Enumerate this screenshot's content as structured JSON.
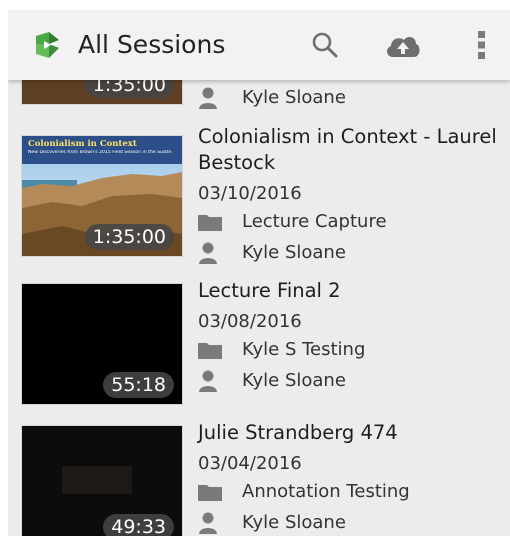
{
  "appbar": {
    "title": "All Sessions",
    "actions": [
      {
        "icon": "search-icon"
      },
      {
        "icon": "cloud-upload-icon"
      },
      {
        "icon": "more-vert-icon"
      }
    ],
    "logo_color": "#3d9a3a"
  },
  "sessions": [
    {
      "title": "",
      "date": "",
      "folder": "",
      "owner": "Kyle Sloane",
      "duration": "1:35:00",
      "thumbnail": "desert"
    },
    {
      "title": "Colonialism in Context - Laurel Bestock",
      "date": "03/10/2016",
      "folder": "Lecture Capture",
      "owner": "Kyle Sloane",
      "duration": "1:35:00",
      "thumbnail": "desert",
      "thumb_heading": "Colonialism in Context",
      "thumb_subheading": "New Discoveries from Brown's 2015 Field Season in the Sudan"
    },
    {
      "title": "Lecture Final 2",
      "date": "03/08/2016",
      "folder": "Kyle S Testing",
      "owner": "Kyle Sloane",
      "duration": "55:18",
      "thumbnail": "black"
    },
    {
      "title": "Julie Strandberg 474",
      "date": "03/04/2016",
      "folder": "Annotation Testing",
      "owner": "Kyle Sloane",
      "duration": "49:33",
      "thumbnail": "dark"
    }
  ]
}
